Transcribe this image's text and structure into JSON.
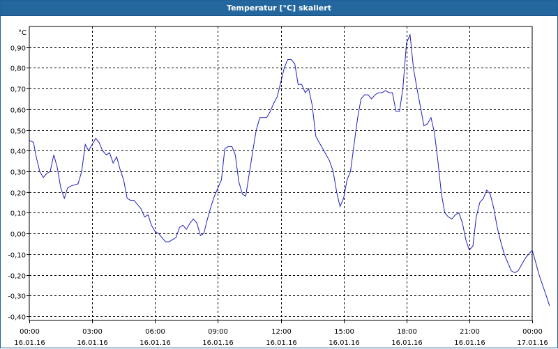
{
  "window": {
    "title": "Temperatur [°C] skaliert"
  },
  "chart_data": {
    "type": "line",
    "title": "Temperatur [°C] skaliert",
    "ylabel": "°C",
    "xlabel": "",
    "ylim": [
      -0.42,
      1.0
    ],
    "xlim": [
      0,
      24
    ],
    "grid": true,
    "line_color": "#1f1fbf",
    "yticks": [
      -0.4,
      -0.3,
      -0.2,
      -0.1,
      0.0,
      0.1,
      0.2,
      0.3,
      0.4,
      0.5,
      0.6,
      0.7,
      0.8,
      0.9
    ],
    "ytick_labels": [
      "-0,40",
      "-0,30",
      "-0,20",
      "-0,10",
      "0,00",
      "0,10",
      "0,20",
      "0,30",
      "0,40",
      "0,50",
      "0,60",
      "0,70",
      "0,80",
      "0,90"
    ],
    "xticks": [
      {
        "x": 0,
        "time": "00:00",
        "date": "16.01.16"
      },
      {
        "x": 3,
        "time": "03:00",
        "date": "16.01.16"
      },
      {
        "x": 6,
        "time": "06:00",
        "date": "16.01.16"
      },
      {
        "x": 9,
        "time": "09:00",
        "date": "16.01.16"
      },
      {
        "x": 12,
        "time": "12:00",
        "date": "16.01.16"
      },
      {
        "x": 15,
        "time": "15:00",
        "date": "16.01.16"
      },
      {
        "x": 18,
        "time": "18:00",
        "date": "16.01.16"
      },
      {
        "x": 21,
        "time": "21:00",
        "date": "16.01.16"
      },
      {
        "x": 24,
        "time": "00:00",
        "date": "17.01.16"
      }
    ],
    "series": [
      {
        "points": [
          [
            0.0,
            0.45
          ],
          [
            0.2,
            0.44
          ],
          [
            0.33,
            0.37
          ],
          [
            0.5,
            0.3
          ],
          [
            0.67,
            0.27
          ],
          [
            0.83,
            0.29
          ],
          [
            1.0,
            0.3
          ],
          [
            1.17,
            0.38
          ],
          [
            1.33,
            0.32
          ],
          [
            1.5,
            0.22
          ],
          [
            1.67,
            0.17
          ],
          [
            1.83,
            0.22
          ],
          [
            2.0,
            0.23
          ],
          [
            2.33,
            0.24
          ],
          [
            2.5,
            0.3
          ],
          [
            2.67,
            0.43
          ],
          [
            2.83,
            0.4
          ],
          [
            3.0,
            0.43
          ],
          [
            3.17,
            0.46
          ],
          [
            3.33,
            0.44
          ],
          [
            3.5,
            0.4
          ],
          [
            3.67,
            0.38
          ],
          [
            3.83,
            0.39
          ],
          [
            4.0,
            0.34
          ],
          [
            4.17,
            0.37
          ],
          [
            4.33,
            0.31
          ],
          [
            4.5,
            0.26
          ],
          [
            4.67,
            0.17
          ],
          [
            4.83,
            0.16
          ],
          [
            5.0,
            0.16
          ],
          [
            5.33,
            0.12
          ],
          [
            5.5,
            0.08
          ],
          [
            5.67,
            0.09
          ],
          [
            5.83,
            0.04
          ],
          [
            6.0,
            0.01
          ],
          [
            6.17,
            0.0
          ],
          [
            6.33,
            -0.02
          ],
          [
            6.5,
            -0.04
          ],
          [
            6.67,
            -0.04
          ],
          [
            6.83,
            -0.03
          ],
          [
            7.0,
            -0.02
          ],
          [
            7.17,
            0.03
          ],
          [
            7.33,
            0.04
          ],
          [
            7.5,
            0.02
          ],
          [
            7.67,
            0.05
          ],
          [
            7.83,
            0.07
          ],
          [
            8.0,
            0.05
          ],
          [
            8.17,
            -0.01
          ],
          [
            8.33,
            0.0
          ],
          [
            8.5,
            0.07
          ],
          [
            8.67,
            0.13
          ],
          [
            8.83,
            0.18
          ],
          [
            9.0,
            0.22
          ],
          [
            9.17,
            0.26
          ],
          [
            9.33,
            0.41
          ],
          [
            9.5,
            0.42
          ],
          [
            9.67,
            0.42
          ],
          [
            9.83,
            0.38
          ],
          [
            10.0,
            0.25
          ],
          [
            10.17,
            0.19
          ],
          [
            10.33,
            0.18
          ],
          [
            10.5,
            0.29
          ],
          [
            10.67,
            0.4
          ],
          [
            10.83,
            0.5
          ],
          [
            11.0,
            0.56
          ],
          [
            11.33,
            0.56
          ],
          [
            11.5,
            0.59
          ],
          [
            11.67,
            0.63
          ],
          [
            11.83,
            0.66
          ],
          [
            12.0,
            0.73
          ],
          [
            12.17,
            0.8
          ],
          [
            12.33,
            0.84
          ],
          [
            12.5,
            0.84
          ],
          [
            12.67,
            0.82
          ],
          [
            12.83,
            0.72
          ],
          [
            13.0,
            0.72
          ],
          [
            13.17,
            0.68
          ],
          [
            13.33,
            0.7
          ],
          [
            13.5,
            0.62
          ],
          [
            13.67,
            0.47
          ],
          [
            13.83,
            0.44
          ],
          [
            14.0,
            0.41
          ],
          [
            14.17,
            0.38
          ],
          [
            14.33,
            0.35
          ],
          [
            14.5,
            0.3
          ],
          [
            14.67,
            0.2
          ],
          [
            14.83,
            0.13
          ],
          [
            15.0,
            0.17
          ],
          [
            15.17,
            0.26
          ],
          [
            15.33,
            0.3
          ],
          [
            15.5,
            0.43
          ],
          [
            15.67,
            0.56
          ],
          [
            15.83,
            0.65
          ],
          [
            16.0,
            0.67
          ],
          [
            16.17,
            0.67
          ],
          [
            16.33,
            0.65
          ],
          [
            16.5,
            0.67
          ],
          [
            16.67,
            0.68
          ],
          [
            16.83,
            0.68
          ],
          [
            17.0,
            0.69
          ],
          [
            17.17,
            0.68
          ],
          [
            17.33,
            0.68
          ],
          [
            17.5,
            0.59
          ],
          [
            17.67,
            0.59
          ],
          [
            17.83,
            0.7
          ],
          [
            18.0,
            0.92
          ],
          [
            18.17,
            0.96
          ],
          [
            18.33,
            0.8
          ],
          [
            18.5,
            0.7
          ],
          [
            18.67,
            0.61
          ],
          [
            18.83,
            0.52
          ],
          [
            19.0,
            0.53
          ],
          [
            19.17,
            0.56
          ],
          [
            19.33,
            0.49
          ],
          [
            19.5,
            0.35
          ],
          [
            19.67,
            0.19
          ],
          [
            19.83,
            0.1
          ],
          [
            20.0,
            0.08
          ],
          [
            20.17,
            0.07
          ],
          [
            20.33,
            0.09
          ],
          [
            20.5,
            0.1
          ],
          [
            20.67,
            0.05
          ],
          [
            20.83,
            -0.03
          ],
          [
            21.0,
            -0.08
          ],
          [
            21.17,
            -0.06
          ],
          [
            21.33,
            0.08
          ],
          [
            21.5,
            0.15
          ],
          [
            21.67,
            0.17
          ],
          [
            21.83,
            0.21
          ],
          [
            22.0,
            0.19
          ],
          [
            22.17,
            0.12
          ],
          [
            22.33,
            0.03
          ],
          [
            22.5,
            -0.04
          ],
          [
            22.67,
            -0.1
          ],
          [
            22.83,
            -0.14
          ],
          [
            23.0,
            -0.18
          ],
          [
            23.17,
            -0.19
          ],
          [
            23.33,
            -0.18
          ],
          [
            23.5,
            -0.15
          ],
          [
            23.67,
            -0.12
          ],
          [
            23.83,
            -0.1
          ],
          [
            24.0,
            -0.08
          ],
          [
            24.17,
            -0.14
          ],
          [
            24.33,
            -0.2
          ],
          [
            24.5,
            -0.25
          ],
          [
            24.67,
            -0.3
          ],
          [
            24.83,
            -0.35
          ]
        ]
      }
    ]
  }
}
